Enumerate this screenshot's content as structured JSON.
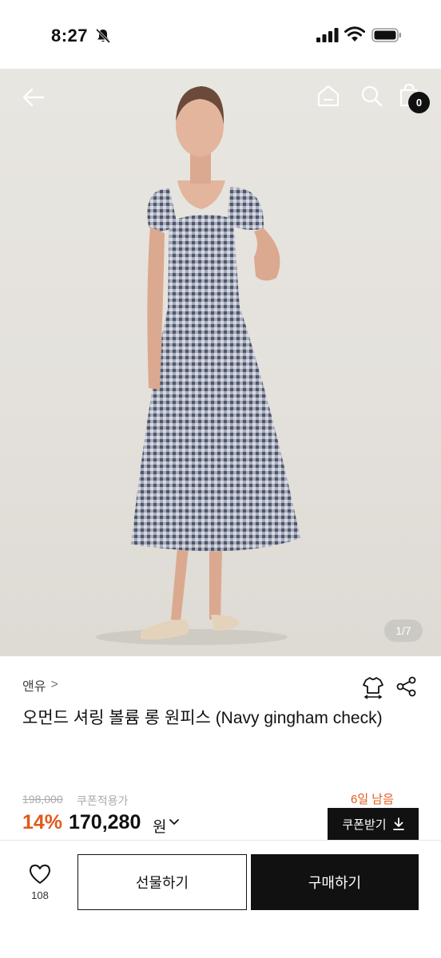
{
  "status_bar": {
    "time": "8:27",
    "icons": [
      "bell-off-icon",
      "signal-icon",
      "wifi-icon",
      "battery-icon"
    ]
  },
  "hero": {
    "image_counter": "1/7",
    "nav": {
      "icons": [
        "back-arrow-icon",
        "home-icon",
        "search-icon",
        "shopping-bag-icon"
      ],
      "cart_count": "0"
    }
  },
  "product": {
    "brand": "앤유",
    "brand_chevron": ">",
    "title": "오먼드 셔링 볼륨 롱 원피스 (Navy gingham check)",
    "original_price": "198,000",
    "coupon_note": "쿠폰적용가",
    "days_left": "6일 남음",
    "discount": "14%",
    "price": "170,280",
    "price_unit": "원",
    "coupon_button": "쿠폰받기"
  },
  "bottom_bar": {
    "like_count": "108",
    "gift_button": "선물하기",
    "buy_button": "구매하기"
  },
  "colors": {
    "accent": "#e05a1a",
    "primary": "#111111",
    "hero_bg": "#e6e3de"
  }
}
